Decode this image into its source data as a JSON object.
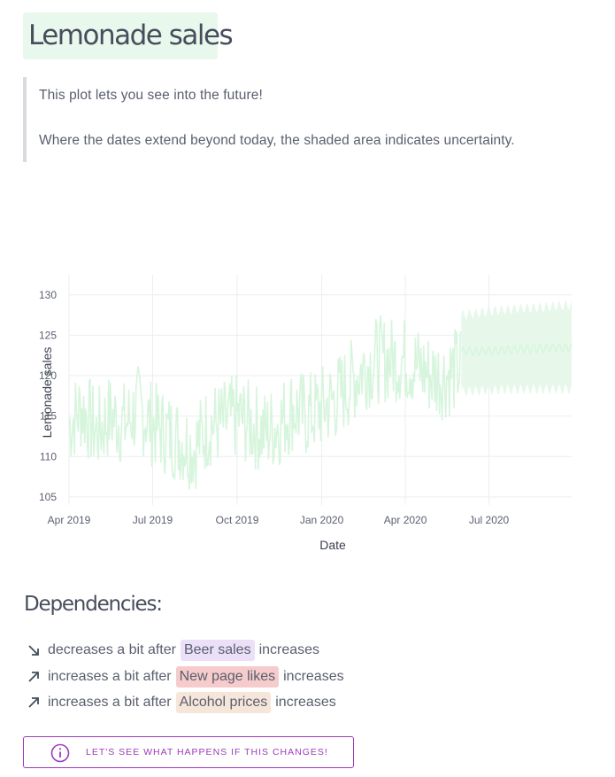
{
  "header": {
    "title": "Lemonade sales"
  },
  "intro": {
    "line1": "This plot lets you see into the future!",
    "line2": "Where the dates extend beyond today, the shaded area indicates uncertainty."
  },
  "chart_data": {
    "type": "line",
    "xlabel": "Date",
    "ylabel": "Lemonade sales",
    "x_range": [
      "2019-04-01",
      "2020-09-29"
    ],
    "ylim": [
      104,
      132.5
    ],
    "y_ticks": [
      105,
      110,
      115,
      120,
      125,
      130
    ],
    "x_ticks": [
      {
        "date": "2019-04-01",
        "label": "Apr 2019"
      },
      {
        "date": "2019-07-01",
        "label": "Jul 2019"
      },
      {
        "date": "2019-10-01",
        "label": "Oct 2019"
      },
      {
        "date": "2020-01-01",
        "label": "Jan 2020"
      },
      {
        "date": "2020-04-01",
        "label": "Apr 2020"
      },
      {
        "date": "2020-07-01",
        "label": "Jul 2020"
      }
    ],
    "grid": true,
    "line_color": "#d7f5dd",
    "band_color": "#e7f8eb",
    "series": [
      {
        "kind": "observed",
        "points": [
          [
            "2019-04-01",
            114
          ],
          [
            "2019-04-15",
            116
          ],
          [
            "2019-05-01",
            113
          ],
          [
            "2019-05-15",
            115
          ],
          [
            "2019-06-01",
            114
          ],
          [
            "2019-06-15",
            116
          ],
          [
            "2019-07-01",
            114
          ],
          [
            "2019-07-15",
            113
          ],
          [
            "2019-08-01",
            112
          ],
          [
            "2019-08-15",
            111
          ],
          [
            "2019-09-01",
            114
          ],
          [
            "2019-09-15",
            114
          ],
          [
            "2019-10-01",
            115
          ],
          [
            "2019-10-15",
            114
          ],
          [
            "2019-11-01",
            113
          ],
          [
            "2019-11-15",
            114
          ],
          [
            "2019-12-01",
            116
          ],
          [
            "2019-12-15",
            115
          ],
          [
            "2020-01-01",
            116
          ],
          [
            "2020-01-15",
            117
          ],
          [
            "2020-02-01",
            119
          ],
          [
            "2020-02-15",
            121
          ],
          [
            "2020-03-01",
            122
          ],
          [
            "2020-03-15",
            122
          ],
          [
            "2020-04-01",
            122
          ],
          [
            "2020-04-15",
            121
          ],
          [
            "2020-05-01",
            120
          ],
          [
            "2020-05-15",
            120
          ],
          [
            "2020-05-31",
            121
          ]
        ]
      },
      {
        "kind": "forecast",
        "points": [
          [
            "2020-06-01",
            123
          ],
          [
            "2020-07-01",
            123
          ],
          [
            "2020-08-01",
            123.3
          ],
          [
            "2020-09-01",
            123.4
          ],
          [
            "2020-09-29",
            123.5
          ]
        ],
        "upper": [
          [
            "2020-06-01",
            127.5
          ],
          [
            "2020-07-01",
            128
          ],
          [
            "2020-08-01",
            128.3
          ],
          [
            "2020-09-01",
            128.5
          ],
          [
            "2020-09-29",
            128.8
          ]
        ],
        "lower": [
          [
            "2020-06-01",
            118
          ],
          [
            "2020-07-01",
            118.2
          ],
          [
            "2020-08-01",
            118.3
          ],
          [
            "2020-09-01",
            118.3
          ],
          [
            "2020-09-29",
            118.3
          ]
        ]
      }
    ]
  },
  "dependencies": {
    "title": "Dependencies:",
    "items": [
      {
        "direction": "down",
        "prefix": "decreases a bit after",
        "factor": "Beer sales",
        "suffix": "increases",
        "color": "#ebe0f8"
      },
      {
        "direction": "up",
        "prefix": "increases a bit after",
        "factor": "New page likes",
        "suffix": "increases",
        "color": "#f5cbcb"
      },
      {
        "direction": "up",
        "prefix": "increases a bit after",
        "factor": "Alcohol prices",
        "suffix": "increases",
        "color": "#f6e6da"
      }
    ]
  },
  "cta": {
    "label": "LET'S SEE WHAT HAPPENS IF THIS CHANGES!",
    "color": "#9c3bb8",
    "icon": "info-circle-icon"
  }
}
